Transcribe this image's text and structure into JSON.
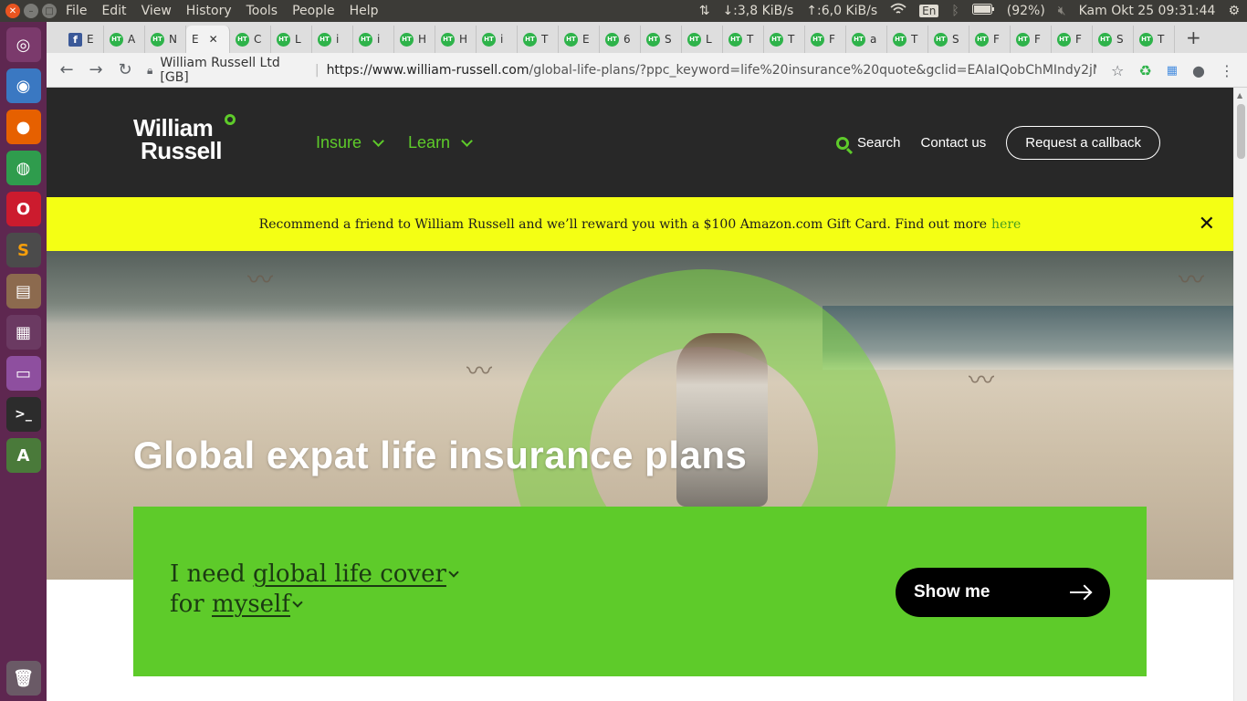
{
  "os": {
    "menu": [
      "File",
      "Edit",
      "View",
      "History",
      "Tools",
      "People",
      "Help"
    ],
    "net_down": "↓:3,8 KiB/s",
    "net_up": "↑:6,0 KiB/s",
    "lang": "En",
    "battery": "(92%)",
    "clock": "Kam Okt 25 09:31:44"
  },
  "tabs": [
    {
      "letter": "E",
      "icon": "facebook-favicon"
    },
    {
      "letter": "A",
      "icon": "site-favicon"
    },
    {
      "letter": "N",
      "icon": "site-favicon"
    },
    {
      "letter": "E",
      "icon": "site-favicon",
      "active": true
    },
    {
      "letter": "C",
      "icon": "site-favicon"
    },
    {
      "letter": "L",
      "icon": "site-favicon"
    },
    {
      "letter": "i",
      "icon": "site-favicon"
    },
    {
      "letter": "i",
      "icon": "site-favicon"
    },
    {
      "letter": "H",
      "icon": "site-favicon"
    },
    {
      "letter": "H",
      "icon": "site-favicon"
    },
    {
      "letter": "i",
      "icon": "site-favicon"
    },
    {
      "letter": "T",
      "icon": "site-favicon"
    },
    {
      "letter": "E",
      "icon": "site-favicon"
    },
    {
      "letter": "6",
      "icon": "site-favicon"
    },
    {
      "letter": "S",
      "icon": "site-favicon"
    },
    {
      "letter": "L",
      "icon": "site-favicon"
    },
    {
      "letter": "T",
      "icon": "site-favicon"
    },
    {
      "letter": "T",
      "icon": "site-favicon"
    },
    {
      "letter": "F",
      "icon": "site-favicon"
    },
    {
      "letter": "a",
      "icon": "site-favicon"
    },
    {
      "letter": "T",
      "icon": "site-favicon"
    },
    {
      "letter": "S",
      "icon": "site-favicon"
    },
    {
      "letter": "F",
      "icon": "site-favicon"
    },
    {
      "letter": "F",
      "icon": "site-favicon"
    },
    {
      "letter": "F",
      "icon": "site-favicon"
    },
    {
      "letter": "S",
      "icon": "site-favicon"
    },
    {
      "letter": "T",
      "icon": "site-favicon"
    }
  ],
  "address": {
    "site_name": "William Russell Ltd [GB]",
    "url_host": "https://www.william-russell.com",
    "url_rest": "/global-life-plans/?ppc_keyword=life%20insurance%20quote&gclid=EAIaIQobChMIndy2jMa..."
  },
  "site": {
    "logo_line1": "William",
    "logo_line2": "Russell",
    "nav_insure": "Insure",
    "nav_learn": "Learn",
    "search": "Search",
    "contact": "Contact us",
    "callback": "Request a callback",
    "promo_text": "Recommend a friend to William Russell and we’ll reward you with a $100 Amazon.com Gift Card. Find out more",
    "promo_link": "here",
    "promo_close": "✕",
    "hero_title": "Global expat life insurance plans",
    "sentence_prefix": "I need",
    "cover_option": "global life cover",
    "sentence_for": "for",
    "who_option": "myself",
    "show_me": "Show me"
  },
  "colors": {
    "brand_green": "#5ecb2a",
    "header_bg": "#282828",
    "promo_bg": "#f4ff14"
  }
}
